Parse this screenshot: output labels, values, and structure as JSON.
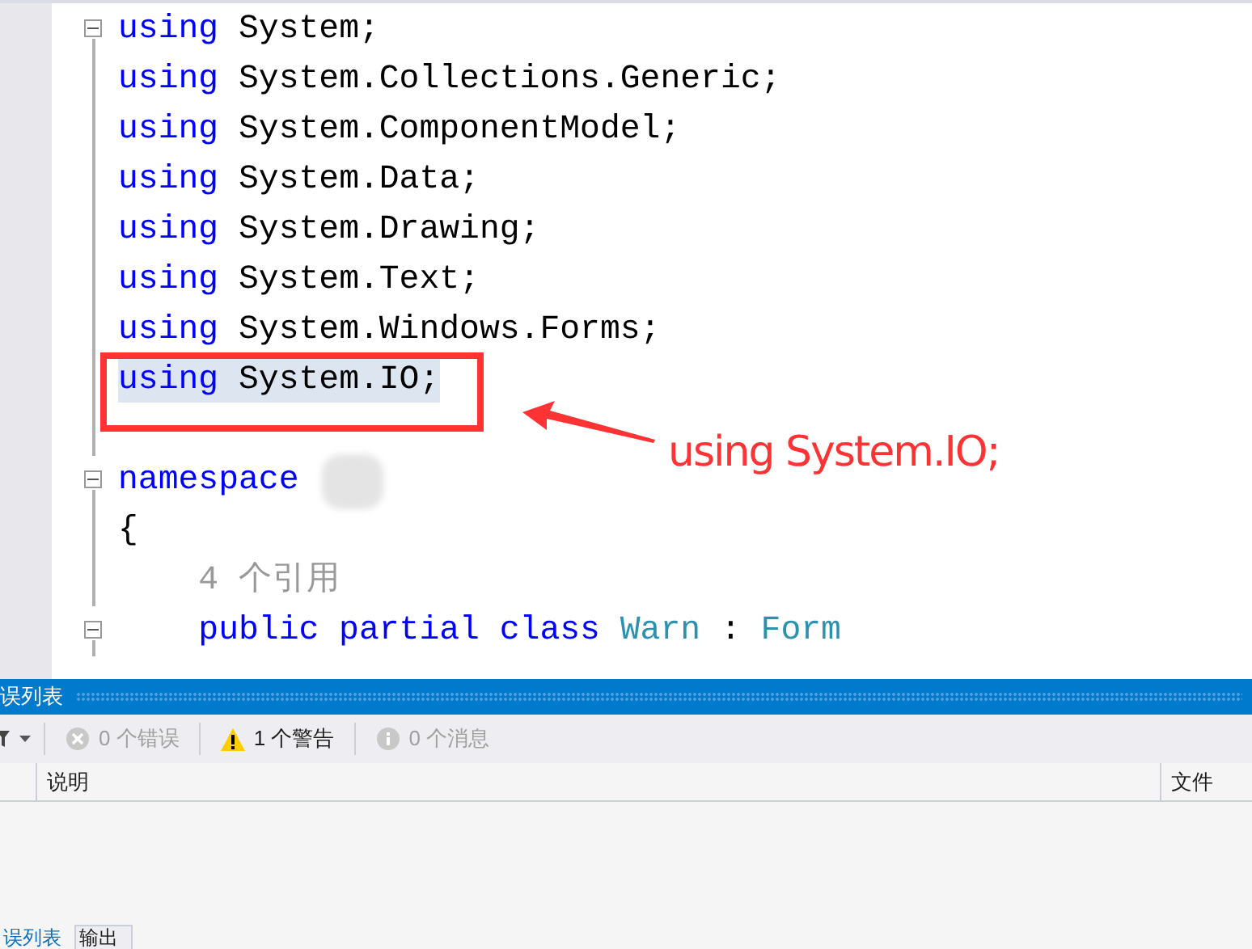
{
  "editor": {
    "lines": [
      {
        "fold": true,
        "highlighted": false,
        "tokens": [
          {
            "kind": "keyword",
            "text": "using"
          },
          {
            "kind": "plain",
            "text": " System;"
          }
        ]
      },
      {
        "fold": false,
        "highlighted": false,
        "tokens": [
          {
            "kind": "keyword",
            "text": "using"
          },
          {
            "kind": "plain",
            "text": " System.Collections.Generic;"
          }
        ]
      },
      {
        "fold": false,
        "highlighted": false,
        "tokens": [
          {
            "kind": "keyword",
            "text": "using"
          },
          {
            "kind": "plain",
            "text": " System.ComponentModel;"
          }
        ]
      },
      {
        "fold": false,
        "highlighted": false,
        "tokens": [
          {
            "kind": "keyword",
            "text": "using"
          },
          {
            "kind": "plain",
            "text": " System.Data;"
          }
        ]
      },
      {
        "fold": false,
        "highlighted": false,
        "tokens": [
          {
            "kind": "keyword",
            "text": "using"
          },
          {
            "kind": "plain",
            "text": " System.Drawing;"
          }
        ]
      },
      {
        "fold": false,
        "highlighted": false,
        "tokens": [
          {
            "kind": "keyword",
            "text": "using"
          },
          {
            "kind": "plain",
            "text": " System.Text;"
          }
        ]
      },
      {
        "fold": false,
        "highlighted": false,
        "tokens": [
          {
            "kind": "keyword",
            "text": "using"
          },
          {
            "kind": "plain",
            "text": " System.Windows.Forms;"
          }
        ]
      },
      {
        "fold": false,
        "highlighted": true,
        "tokens": [
          {
            "kind": "keyword",
            "text": "using"
          },
          {
            "kind": "plain",
            "text": " System.IO;"
          }
        ]
      },
      {
        "fold": false
      },
      {
        "fold": true,
        "highlighted": false,
        "redacted": true,
        "tokens": [
          {
            "kind": "keyword",
            "text": "namespace"
          }
        ]
      },
      {
        "fold": false,
        "highlighted": false,
        "tokens": [
          {
            "kind": "plain",
            "text": "{"
          }
        ]
      },
      {
        "fold": false,
        "highlighted": false,
        "tokens": [
          {
            "kind": "codelens",
            "text": "    4 个引用"
          }
        ]
      },
      {
        "fold": true,
        "highlighted": false,
        "tokens": [
          {
            "kind": "keyword",
            "text": "    public partial class "
          },
          {
            "kind": "type",
            "text": "Warn"
          },
          {
            "kind": "plain",
            "text": " : "
          },
          {
            "kind": "type",
            "text": "Form"
          }
        ]
      }
    ]
  },
  "annotation": {
    "text": "using System.IO;"
  },
  "error_list": {
    "title": "误列表",
    "filters": [
      {
        "kind": "error",
        "label": "0 个错误",
        "active": false
      },
      {
        "kind": "warning",
        "label": "1 个警告",
        "active": true
      },
      {
        "kind": "message",
        "label": "0 个消息",
        "active": false
      }
    ],
    "columns": [
      "说明",
      "文件"
    ]
  },
  "bottom_tabs": [
    {
      "label": "误列表",
      "selected": true
    },
    {
      "label": "输出",
      "selected": false
    }
  ]
}
